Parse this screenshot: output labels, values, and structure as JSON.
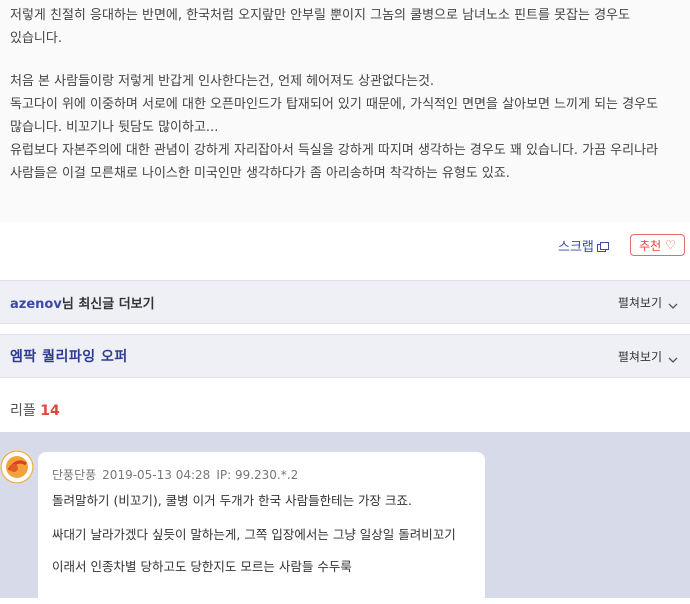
{
  "article": {
    "paragraphs": [
      "저렇게 친절히 응대하는 반면에, 한국처럼 오지랖만 안부릴 뿐이지 그놈의 쿨병으로 남녀노소 핀트를 못잡는 경우도 있습니다.",
      "처음 본 사람들이랑 저렇게 반갑게 인사한다는건, 언제 헤어져도 상관없다는것.\n독고다이 위에 이중하며 서로에 대한 오픈마인드가 탑재되어 있기 때문에, 가식적인 면면을 살아보면 느끼게 되는 경우도 많습니다. 비꼬기나 뒷담도 많이하고...\n유럽보다 자본주의에 대한 관념이 강하게 자리잡아서 득실을 강하게 따지며 생각하는 경우도 꽤 있습니다. 가끔 우리나라 사람들은 이걸 모른채로 나이스한 미국인만 생각하다가 좀 아리송하며 착각하는 유형도 있죠."
    ]
  },
  "actions": {
    "scrap_label": "스크랩",
    "recommend_label": "추천",
    "heart_glyph": "♡"
  },
  "more_bar": {
    "username": "azenov",
    "suffix": "님 최신글 더보기",
    "expand_label": "펼쳐보기"
  },
  "emp_bar": {
    "title": "엠팍 퀄리파잉 오퍼",
    "expand_label": "펼쳐보기"
  },
  "replies": {
    "label": "리플",
    "count": "14"
  },
  "comment": {
    "author": "단풍단풍",
    "datetime": "2019-05-13 04:28",
    "ip": "IP: 99.230.*.2",
    "lines": [
      "돌려말하기 (비꼬기), 쿨병 이거 두개가 한국 사람들한테는 가장 크죠.",
      "싸대기 날라가겠다 싶듯이 말하는게, 그쪽 입장에서는 그냥 일상일 돌려비꼬기",
      "이래서 인종차별 당하고도 당한지도 모르는 사람들 수두룩"
    ]
  },
  "colors": {
    "accent": "#3b4aa8",
    "recommend": "#e0473f",
    "bar_bg": "#eef0f5",
    "comment_bg": "#d6dae9"
  }
}
